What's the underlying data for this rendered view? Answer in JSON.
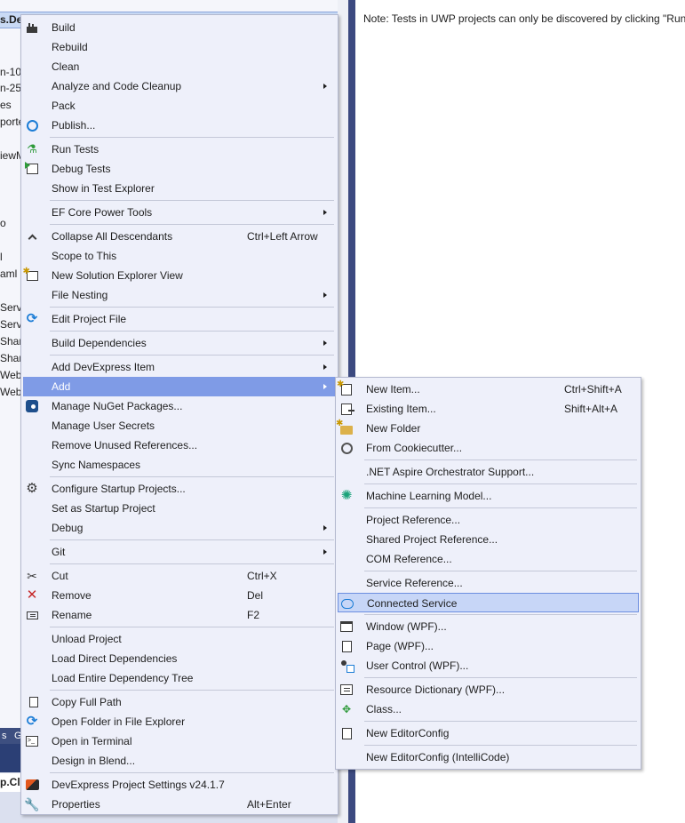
{
  "background": {
    "selected_row_text": "s.De",
    "left_fragments": [
      "n-10",
      "n-25",
      "es",
      "porte",
      "iewM",
      "o",
      "l",
      "aml",
      "Serv",
      "Serv",
      "Shar",
      "Shar",
      "Web",
      "Web"
    ],
    "bottom_tabs": [
      "s",
      "G"
    ],
    "combo_text": "p.Cl",
    "test_explorer_note": "Note: Tests in UWP projects can only be discovered by clicking \"Run"
  },
  "context_menu": {
    "items": [
      {
        "icon": "build-icon",
        "label": "Build"
      },
      {
        "label": "Rebuild"
      },
      {
        "label": "Clean"
      },
      {
        "label": "Analyze and Code Cleanup",
        "submenu": true
      },
      {
        "label": "Pack"
      },
      {
        "icon": "globe-icon",
        "label": "Publish..."
      },
      {
        "icon": "run-tests-icon",
        "label": "Run Tests"
      },
      {
        "icon": "debug-tests-icon",
        "label": "Debug Tests"
      },
      {
        "label": "Show in Test Explorer"
      },
      {
        "label": "EF Core Power Tools",
        "submenu": true
      },
      {
        "icon": "collapse-icon",
        "label": "Collapse All Descendants",
        "shortcut": "Ctrl+Left Arrow"
      },
      {
        "label": "Scope to This"
      },
      {
        "icon": "new-view-icon",
        "label": "New Solution Explorer View"
      },
      {
        "label": "File Nesting",
        "submenu": true
      },
      {
        "icon": "edit-project-icon",
        "label": "Edit Project File"
      },
      {
        "label": "Build Dependencies",
        "submenu": true
      },
      {
        "label": "Add DevExpress Item",
        "submenu": true
      },
      {
        "label": "Add",
        "submenu": true
      },
      {
        "icon": "nuget-icon",
        "label": "Manage NuGet Packages..."
      },
      {
        "label": "Manage User Secrets"
      },
      {
        "label": "Remove Unused References..."
      },
      {
        "label": "Sync Namespaces"
      },
      {
        "icon": "gear-icon",
        "label": "Configure Startup Projects..."
      },
      {
        "label": "Set as Startup Project"
      },
      {
        "label": "Debug",
        "submenu": true
      },
      {
        "label": "Git",
        "submenu": true
      },
      {
        "icon": "cut-icon",
        "label": "Cut",
        "shortcut": "Ctrl+X"
      },
      {
        "icon": "remove-icon",
        "label": "Remove",
        "shortcut": "Del"
      },
      {
        "icon": "rename-icon",
        "label": "Rename",
        "shortcut": "F2"
      },
      {
        "label": "Unload Project"
      },
      {
        "label": "Load Direct Dependencies"
      },
      {
        "label": "Load Entire Dependency Tree"
      },
      {
        "icon": "copy-icon",
        "label": "Copy Full Path"
      },
      {
        "icon": "open-folder-icon",
        "label": "Open Folder in File Explorer"
      },
      {
        "icon": "terminal-icon",
        "label": "Open in Terminal"
      },
      {
        "label": "Design in Blend..."
      },
      {
        "icon": "devexpress-icon",
        "label": "DevExpress Project Settings v24.1.7"
      },
      {
        "icon": "wrench-icon",
        "label": "Properties",
        "shortcut": "Alt+Enter"
      }
    ]
  },
  "add_submenu": {
    "items": [
      {
        "icon": "new-item-icon",
        "label": "New Item...",
        "shortcut": "Ctrl+Shift+A"
      },
      {
        "icon": "existing-item-icon",
        "label": "Existing Item...",
        "shortcut": "Shift+Alt+A"
      },
      {
        "icon": "new-folder-icon",
        "label": "New Folder"
      },
      {
        "icon": "cookiecutter-icon",
        "label": "From Cookiecutter..."
      },
      {
        "label": ".NET Aspire Orchestrator Support..."
      },
      {
        "icon": "machine-learning-icon",
        "label": "Machine Learning Model..."
      },
      {
        "label": "Project Reference..."
      },
      {
        "label": "Shared Project Reference..."
      },
      {
        "label": "COM Reference..."
      },
      {
        "label": "Service Reference..."
      },
      {
        "icon": "connected-service-icon",
        "label": "Connected Service"
      },
      {
        "icon": "window-icon",
        "label": "Window (WPF)..."
      },
      {
        "icon": "page-icon",
        "label": "Page (WPF)..."
      },
      {
        "icon": "user-control-icon",
        "label": "User Control (WPF)..."
      },
      {
        "icon": "resource-dictionary-icon",
        "label": "Resource Dictionary (WPF)..."
      },
      {
        "icon": "class-icon",
        "label": "Class..."
      },
      {
        "icon": "editorconfig-icon",
        "label": "New EditorConfig"
      },
      {
        "label": "New EditorConfig (IntelliCode)"
      }
    ]
  },
  "colors": {
    "menu_background": "#eef0fa",
    "highlight": "#c7d6f7",
    "submenu_open": "#7f9be6",
    "splitter": "#3c4a80"
  }
}
